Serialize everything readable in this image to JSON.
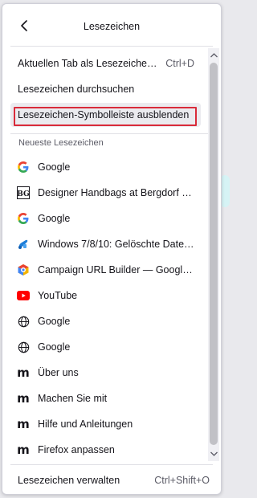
{
  "header": {
    "title": "Lesezeichen",
    "back_icon": "back-arrow-icon"
  },
  "menu": [
    {
      "label": "Aktuellen Tab als Lesezeichen h...",
      "shortcut": "Ctrl+D"
    },
    {
      "label": "Lesezeichen durchsuchen",
      "shortcut": ""
    },
    {
      "label": "Lesezeichen-Symbolleiste ausblenden",
      "shortcut": "",
      "highlighted": true
    }
  ],
  "recent_section_title": "Neueste Lesezeichen",
  "bookmarks": [
    {
      "label": "Google",
      "icon": "google-icon"
    },
    {
      "label": "Designer Handbags at Bergdorf Go...",
      "icon": "bergdorf-bg-icon",
      "icon_text": "BG"
    },
    {
      "label": "Google",
      "icon": "google-icon"
    },
    {
      "label": "Windows 7/8/10: Gelöschte Dateien...",
      "icon": "windows-blue-icon"
    },
    {
      "label": "Campaign URL Builder — Google A...",
      "icon": "campaign-url-builder-icon"
    },
    {
      "label": "YouTube",
      "icon": "youtube-icon"
    },
    {
      "label": "Google",
      "icon": "globe-icon"
    },
    {
      "label": "Google",
      "icon": "globe-icon"
    },
    {
      "label": "Über uns",
      "icon": "mozilla-m-icon",
      "icon_text": "m"
    },
    {
      "label": "Machen Sie mit",
      "icon": "mozilla-m-icon",
      "icon_text": "m"
    },
    {
      "label": "Hilfe und Anleitungen",
      "icon": "mozilla-m-icon",
      "icon_text": "m"
    },
    {
      "label": "Firefox anpassen",
      "icon": "mozilla-m-icon",
      "icon_text": "m"
    }
  ],
  "footer": {
    "label": "Lesezeichen verwalten",
    "shortcut": "Ctrl+Shift+O"
  },
  "colors": {
    "highlight_border": "#d92b3a",
    "youtube_red": "#ff0000",
    "google_blue": "#4285f4",
    "google_red": "#ea4335",
    "google_yellow": "#fbbc05",
    "google_green": "#34a853"
  }
}
